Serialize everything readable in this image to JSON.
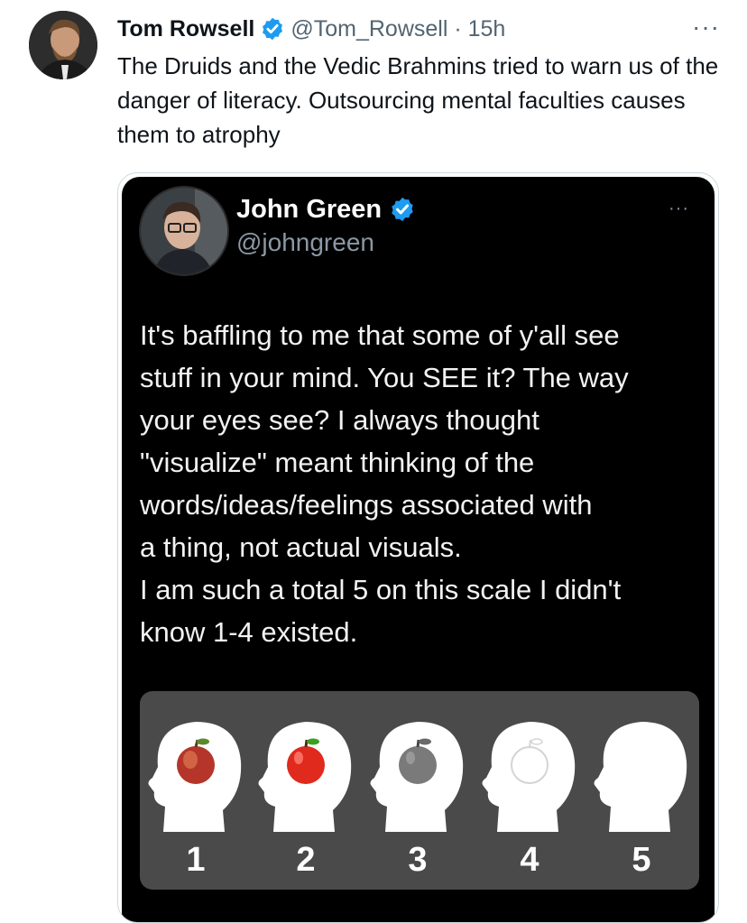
{
  "post": {
    "author_name": "Tom Rowsell",
    "handle_time": "@Tom_Rowsell · 15h",
    "more_label": "···",
    "text": "The Druids and the Vedic Brahmins tried to warn us of the danger of literacy. Outsourcing mental faculties causes them to atrophy",
    "avatar_icon": "person-avatar-icon",
    "verified_color": "#1d9bf0"
  },
  "quoted": {
    "author_name": "John Green",
    "handle": "@johngreen",
    "more_label": "···",
    "text_lines": [
      "It's baffling to me that some of y'all see",
      "stuff in your mind. You SEE it? The way",
      "your eyes see? I always thought",
      "\"visualize\" meant thinking of the",
      "words/ideas/feelings associated with",
      "a thing, not actual visuals.",
      "I am such a total 5 on this scale I didn't",
      "know 1-4 existed."
    ],
    "scale": {
      "labels": [
        "1",
        "2",
        "3",
        "4",
        "5"
      ],
      "apple_styles": [
        "realistic",
        "cartoon-red",
        "grayscale",
        "outline",
        "none"
      ]
    }
  },
  "colors": {
    "background": "#ffffff",
    "text": "#0f1419",
    "secondary_text": "#536471",
    "quote_background": "#000000",
    "panel_background": "#4a4a4a"
  }
}
